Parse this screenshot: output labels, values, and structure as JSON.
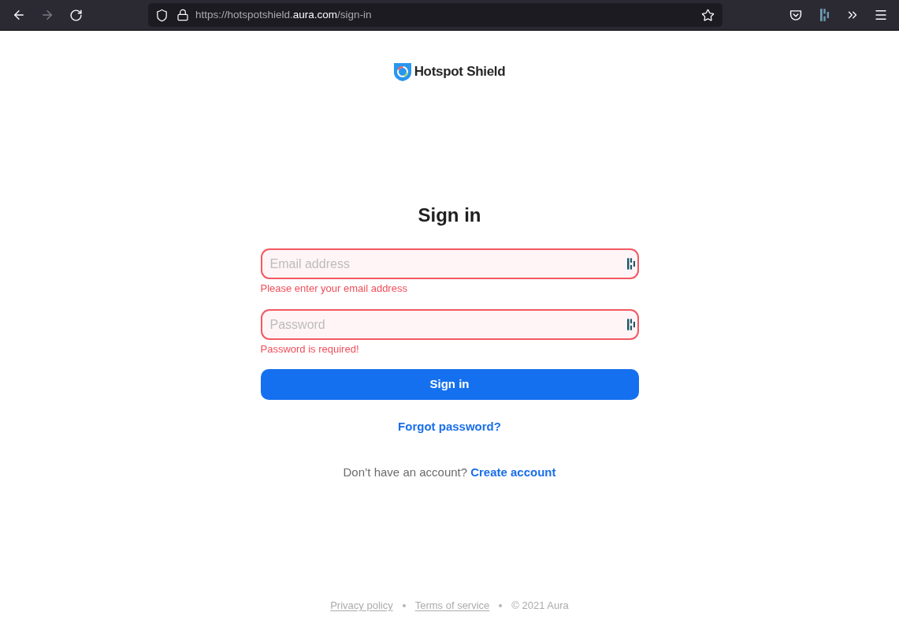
{
  "browser": {
    "nav_buttons": [
      {
        "kind": "back",
        "disabled": false
      },
      {
        "kind": "forward",
        "disabled": true
      },
      {
        "kind": "reload",
        "disabled": false
      }
    ],
    "url": {
      "host_start": "https://hotspotshield.",
      "domain": "aura.com",
      "path": "/sign-in"
    }
  },
  "logo": {
    "text": "Hotspot Shield"
  },
  "heading": "Sign in",
  "fields": [
    {
      "placeholder": "Email address",
      "invalid": true,
      "error": "Please enter your email address"
    },
    {
      "placeholder": "Password",
      "invalid": true,
      "error": "Password is required!"
    }
  ],
  "submit": {
    "label": "Sign in"
  },
  "forgot_link": "Forgot password?",
  "signup": {
    "prompt": "Don’t have an account?",
    "link": "Create account"
  },
  "footer": {
    "items": [
      {
        "kind": "link",
        "text": "Privacy policy"
      },
      {
        "kind": "link",
        "text": "Terms of service"
      },
      {
        "kind": "text",
        "text": "© 2021 Aura"
      }
    ]
  }
}
